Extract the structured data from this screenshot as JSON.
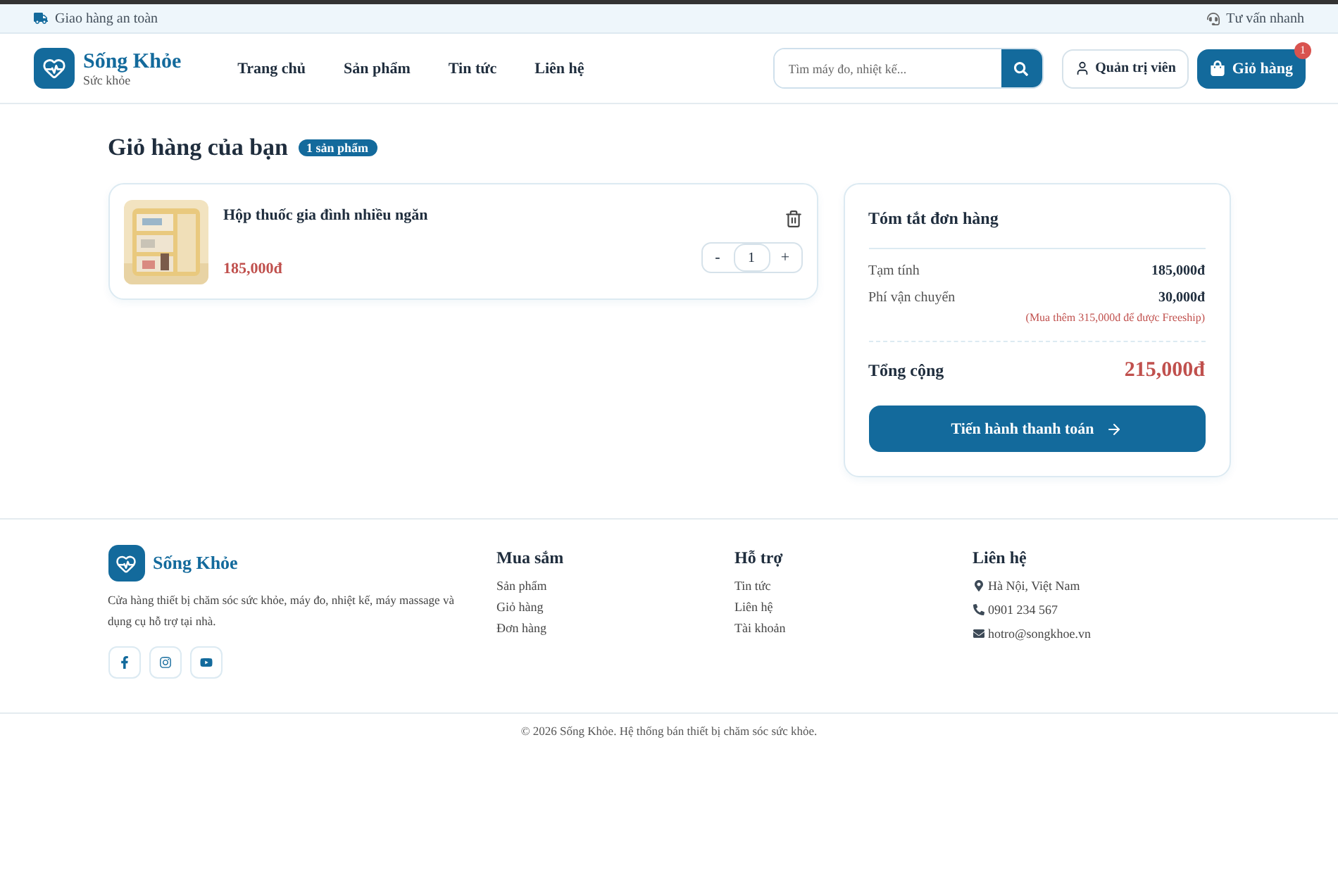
{
  "top_bar": {
    "left": "Giao hàng an toàn",
    "right": "Tư vấn nhanh"
  },
  "header": {
    "brand": {
      "name": "Sống Khỏe",
      "tagline": "Sức khỏe"
    },
    "nav": [
      "Trang chủ",
      "Sản phẩm",
      "Tin tức",
      "Liên hệ"
    ],
    "search": {
      "placeholder": "Tìm máy đo, nhiệt kế..."
    },
    "admin_button": "Quản trị viên",
    "cart_button": {
      "label": "Giỏ hàng",
      "count": "1"
    }
  },
  "cart": {
    "title": "Giỏ hàng của bạn",
    "badge": "1 sản phẩm",
    "items": [
      {
        "name": "Hộp thuốc gia đình nhiều ngăn",
        "price": "185,000đ",
        "decrease": "-",
        "quantity": "1",
        "increase": "+"
      }
    ]
  },
  "summary": {
    "title": "Tóm tắt đơn hàng",
    "rows": [
      {
        "label": "Tạm tính",
        "value": "185,000đ"
      },
      {
        "label": "Phí vận chuyển",
        "value": "30,000đ",
        "note": "(Mua thêm 315,000đ để được Freeship)"
      }
    ],
    "total_label": "Tổng cộng",
    "total_value": "215,000đ",
    "checkout_button": "Tiến hành thanh toán"
  },
  "footer": {
    "brand": "Sống Khỏe",
    "description": "Cửa hàng thiết bị chăm sóc sức khỏe, máy đo, nhiệt kế, máy massage và dụng cụ hỗ trợ tại nhà.",
    "socials": [
      {
        "kind": "facebook"
      },
      {
        "kind": "instagram"
      },
      {
        "kind": "youtube"
      }
    ],
    "columns": [
      {
        "title": "Mua sắm",
        "links": [
          "Sản phẩm",
          "Giỏ hàng",
          "Đơn hàng"
        ]
      },
      {
        "title": "Hỗ trợ",
        "links": [
          "Tin tức",
          "Liên hệ",
          "Tài khoản"
        ]
      }
    ],
    "contact": {
      "title": "Liên hệ",
      "items": [
        {
          "kind": "address",
          "text": "Hà Nội, Việt Nam"
        },
        {
          "kind": "phone",
          "text": "0901 234 567"
        },
        {
          "kind": "email",
          "text": "hotro@songkhoe.vn"
        }
      ]
    },
    "copyright": "© 2026 Sống Khỏe. Hệ thống bán thiết bị chăm sóc sức khỏe."
  }
}
